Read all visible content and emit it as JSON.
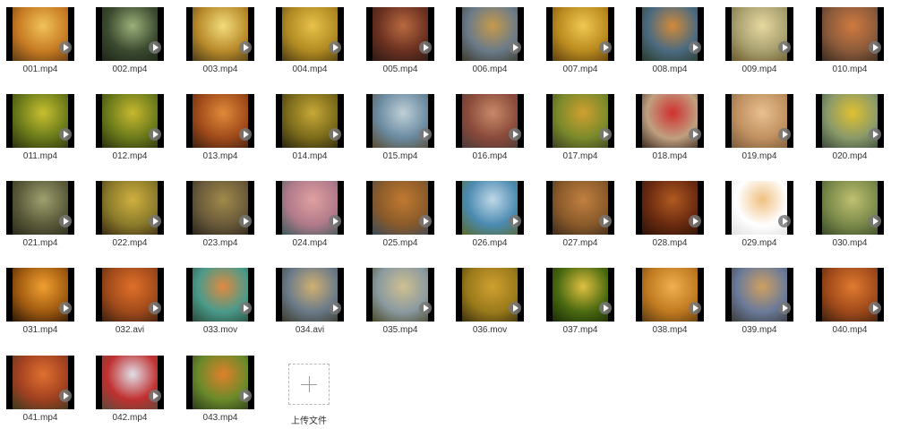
{
  "files": [
    {
      "name": "001.mp4",
      "c1": "#c77a22",
      "c2": "#f0c35a",
      "c3": "#5a3a15"
    },
    {
      "name": "002.mp4",
      "c1": "#3b4a2f",
      "c2": "#9bb07a",
      "c3": "#1d2418"
    },
    {
      "name": "003.mp4",
      "c1": "#b88a2a",
      "c2": "#f3dc7c",
      "c3": "#4a3a1a"
    },
    {
      "name": "004.mp4",
      "c1": "#b08a22",
      "c2": "#e8c24a",
      "c3": "#4b3a12"
    },
    {
      "name": "005.mp4",
      "c1": "#6a3020",
      "c2": "#b86a40",
      "c3": "#2a1a14"
    },
    {
      "name": "006.mp4",
      "c1": "#6a7a8a",
      "c2": "#c69a4a",
      "c3": "#3a3a2a"
    },
    {
      "name": "007.mp4",
      "c1": "#b98a1e",
      "c2": "#f0c852",
      "c3": "#5a3d10"
    },
    {
      "name": "008.mp4",
      "c1": "#4a6a80",
      "c2": "#d28a3a",
      "c3": "#2a3a2a"
    },
    {
      "name": "009.mp4",
      "c1": "#a8a070",
      "c2": "#e8d8a0",
      "c3": "#6a5a2a"
    },
    {
      "name": "010.mp4",
      "c1": "#8a5a3a",
      "c2": "#d07a40",
      "c3": "#3a2a20"
    },
    {
      "name": "011.mp4",
      "c1": "#6a7a1a",
      "c2": "#c8c030",
      "c3": "#2a3010"
    },
    {
      "name": "012.mp4",
      "c1": "#6a7a1a",
      "c2": "#c8b830",
      "c3": "#2a3010"
    },
    {
      "name": "013.mp4",
      "c1": "#a04a1a",
      "c2": "#e08a3a",
      "c3": "#3a2010"
    },
    {
      "name": "014.mp4",
      "c1": "#7a6a1a",
      "c2": "#c8a838",
      "c3": "#2a2410"
    },
    {
      "name": "015.mp4",
      "c1": "#6a8aa0",
      "c2": "#c0d0d8",
      "c3": "#5a4a30"
    },
    {
      "name": "016.mp4",
      "c1": "#8a4a3a",
      "c2": "#c88a6a",
      "c3": "#4a3a3a"
    },
    {
      "name": "017.mp4",
      "c1": "#7a8a2a",
      "c2": "#d0a030",
      "c3": "#3a4020"
    },
    {
      "name": "018.mp4",
      "c1": "#c0a080",
      "c2": "#d03030",
      "c3": "#3a2a20"
    },
    {
      "name": "019.mp4",
      "c1": "#c09060",
      "c2": "#e8c090",
      "c3": "#7a5a3a"
    },
    {
      "name": "020.mp4",
      "c1": "#8a9a6a",
      "c2": "#e0c030",
      "c3": "#3a4a3a"
    },
    {
      "name": "021.mp4",
      "c1": "#5a5a3a",
      "c2": "#a0a070",
      "c3": "#2a2a1a"
    },
    {
      "name": "022.mp4",
      "c1": "#8a7a2a",
      "c2": "#d0b040",
      "c3": "#3a2a14"
    },
    {
      "name": "023.mp4",
      "c1": "#6a5a3a",
      "c2": "#a08a4a",
      "c3": "#2a241a"
    },
    {
      "name": "024.mp4",
      "c1": "#b07a8a",
      "c2": "#e0a0a0",
      "c3": "#3a5a5a"
    },
    {
      "name": "025.mp4",
      "c1": "#8a5a2a",
      "c2": "#c07a30",
      "c3": "#3a4a5a"
    },
    {
      "name": "026.mp4",
      "c1": "#4a8ab0",
      "c2": "#c0d8e8",
      "c3": "#5a6a2a"
    },
    {
      "name": "027.mp4",
      "c1": "#8a5a2a",
      "c2": "#c08040",
      "c3": "#3a2a1a"
    },
    {
      "name": "028.mp4",
      "c1": "#6a2a10",
      "c2": "#b05a20",
      "c3": "#2a1208"
    },
    {
      "name": "029.mp4",
      "c1": "#ffffff",
      "c2": "#f0c080",
      "c3": "#e0e0e0"
    },
    {
      "name": "030.mp4",
      "c1": "#7a8a4a",
      "c2": "#c0c070",
      "c3": "#3a4a2a"
    },
    {
      "name": "031.mp4",
      "c1": "#a05a10",
      "c2": "#f0a030",
      "c3": "#2a1808"
    },
    {
      "name": "032.avi",
      "c1": "#a04a1a",
      "c2": "#e0702a",
      "c3": "#3a2010"
    },
    {
      "name": "033.mov",
      "c1": "#4a9a8a",
      "c2": "#e08a40",
      "c3": "#2a4a3a"
    },
    {
      "name": "034.avi",
      "c1": "#6a7a8a",
      "c2": "#d0b070",
      "c3": "#3a3a2a"
    },
    {
      "name": "035.mp4",
      "c1": "#8a9aa0",
      "c2": "#d0c090",
      "c3": "#4a4a2a"
    },
    {
      "name": "036.mov",
      "c1": "#9a7a1a",
      "c2": "#d0a030",
      "c3": "#3a3010"
    },
    {
      "name": "037.mp4",
      "c1": "#4a6a10",
      "c2": "#e0c040",
      "c3": "#1a2a08"
    },
    {
      "name": "038.mp4",
      "c1": "#c07a20",
      "c2": "#f0b050",
      "c3": "#5a3a10"
    },
    {
      "name": "039.mp4",
      "c1": "#6a7a9a",
      "c2": "#d0a060",
      "c3": "#3a3a3a"
    },
    {
      "name": "040.mp4",
      "c1": "#a04a1a",
      "c2": "#e07a30",
      "c3": "#3a2010"
    },
    {
      "name": "041.mp4",
      "c1": "#a04020",
      "c2": "#e07030",
      "c3": "#3a3a20"
    },
    {
      "name": "042.mp4",
      "c1": "#c03030",
      "c2": "#e0e0e8",
      "c3": "#5a4a3a"
    },
    {
      "name": "043.mp4",
      "c1": "#6a8a2a",
      "c2": "#e0802a",
      "c3": "#2a3a1a"
    }
  ],
  "upload": {
    "label": "上传文件"
  }
}
